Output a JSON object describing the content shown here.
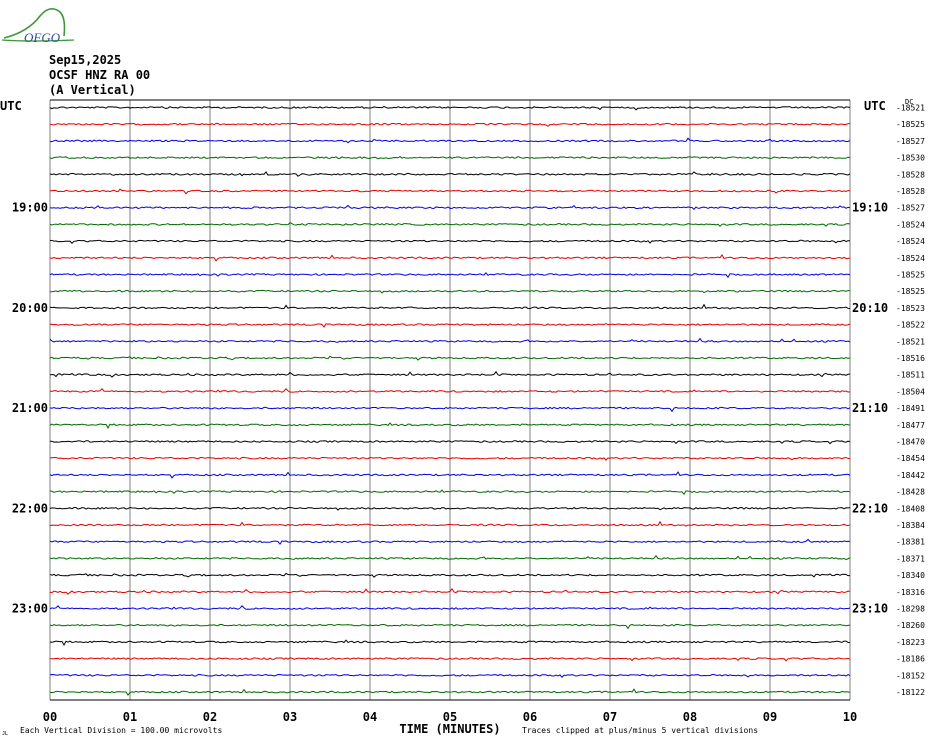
{
  "header": {
    "date": "Sep15,2025",
    "station": "OCSF HNZ RA 00",
    "component": "(A Vertical)",
    "logo_text": "OFGO"
  },
  "chart_data": {
    "type": "line",
    "title": "",
    "xlabel": "TIME (MINUTES)",
    "x_ticks": [
      "00",
      "01",
      "02",
      "03",
      "04",
      "05",
      "06",
      "07",
      "08",
      "09",
      "10"
    ],
    "xlim": [
      0,
      10
    ],
    "left_axis_label": "UTC",
    "right_axis_label": "UTC",
    "right_extra_label": "DC",
    "hour_labels_left": [
      {
        "row": 6,
        "text": "19:00"
      },
      {
        "row": 12,
        "text": "20:00"
      },
      {
        "row": 18,
        "text": "21:00"
      },
      {
        "row": 24,
        "text": "22:00"
      },
      {
        "row": 30,
        "text": "23:00"
      }
    ],
    "hour_labels_right": [
      {
        "row": 6,
        "text": "19:10"
      },
      {
        "row": 12,
        "text": "20:10"
      },
      {
        "row": 18,
        "text": "21:10"
      },
      {
        "row": 24,
        "text": "22:10"
      },
      {
        "row": 30,
        "text": "23:10"
      }
    ],
    "trace_colors": [
      "#000000",
      "#e00000",
      "#0000e0",
      "#006a00"
    ],
    "trace_offsets": [
      -18521,
      -18525,
      -18527,
      -18530,
      -18528,
      -18528,
      -18527,
      -18524,
      -18524,
      -18524,
      -18525,
      -18525,
      -18523,
      -18522,
      -18521,
      -18516,
      -18511,
      -18504,
      -18491,
      -18477,
      -18470,
      -18454,
      -18442,
      -18428,
      -18408,
      -18384,
      -18381,
      -18371,
      -18340,
      -18316,
      -18298,
      -18260,
      -18223,
      -18186,
      -18152,
      -18122
    ],
    "scale_note": "Each Vertical Division =  100.00 microvolts",
    "clip_note": "Traces clipped at plus/minus 5 vertical divisions",
    "corner_mark": "JL"
  },
  "colors": {
    "grid": "#7f7f7f",
    "frame": "#000000",
    "logo_green": "#3a9a3a",
    "logo_blue": "#2d4fa0"
  }
}
